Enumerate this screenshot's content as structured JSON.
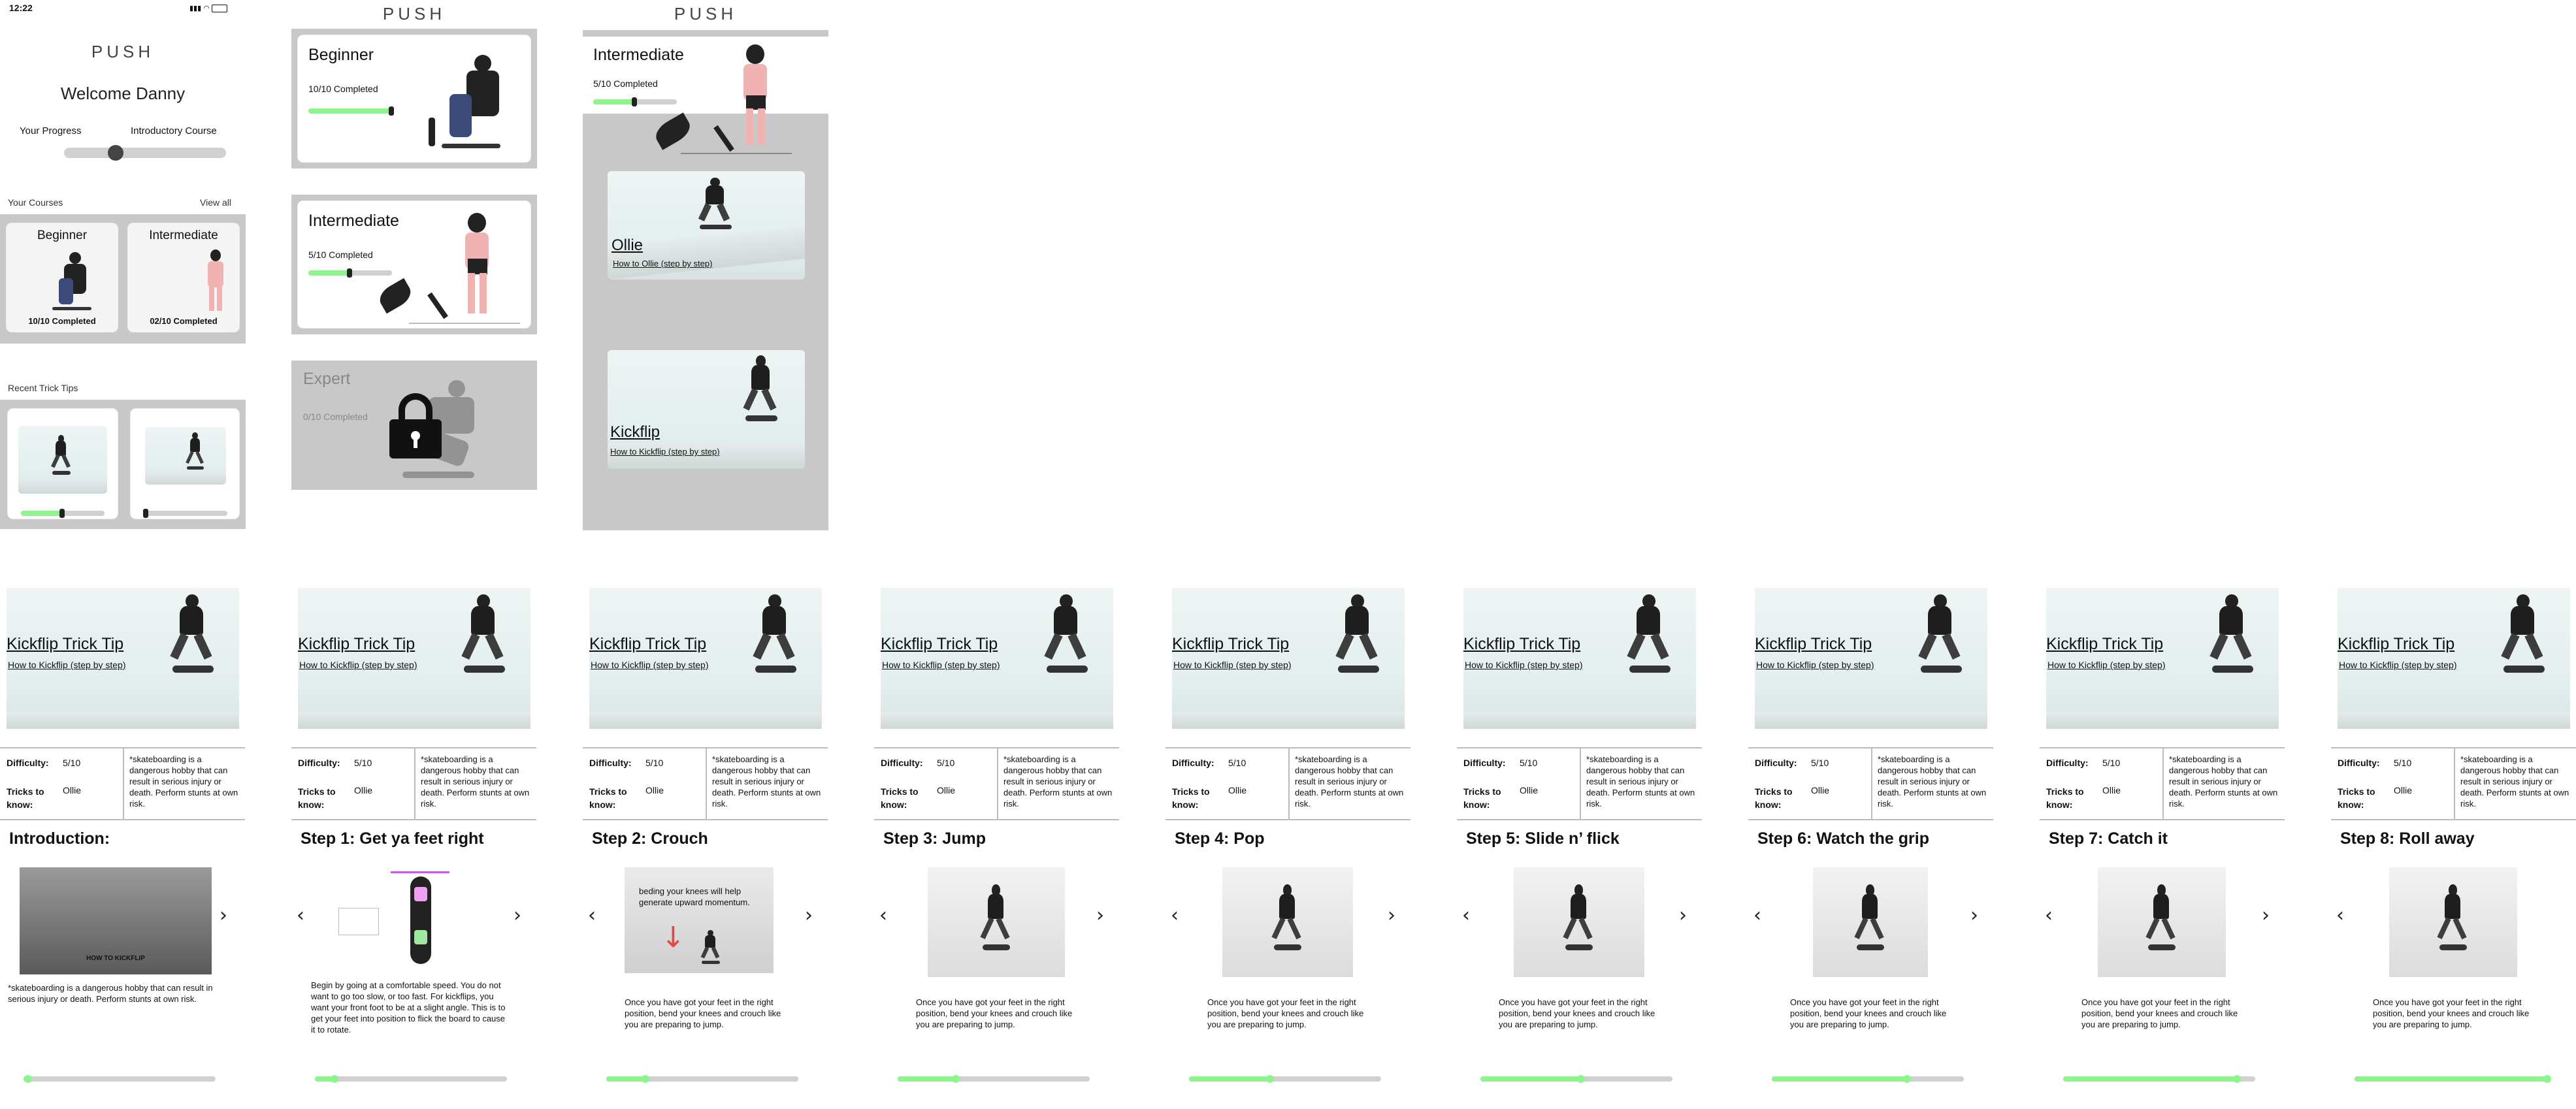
{
  "status_bar": {
    "time": "12:22"
  },
  "brand": "PUSH",
  "home": {
    "welcome": "Welcome Danny",
    "your_progress": "Your Progress",
    "introductory_course": "Introductory Course",
    "progress_value": 0.32,
    "your_courses": "Your Courses",
    "view_all": "View all",
    "courses": [
      {
        "title": "Beginner",
        "completed": "10/10 Completed",
        "progress": 1.0
      },
      {
        "title": "Intermediate",
        "completed": "02/10 Completed",
        "progress": 0.2
      }
    ],
    "recent_trick_tips": "Recent Trick Tips",
    "trick_progress": [
      0.5,
      0.03
    ]
  },
  "courses_screen": {
    "items": [
      {
        "title": "Beginner",
        "completed": "10/10 Completed",
        "progress": 1.0,
        "locked": false
      },
      {
        "title": "Intermediate",
        "completed": "5/10 Completed",
        "progress": 0.5,
        "locked": false
      },
      {
        "title": "Expert",
        "completed": "0/10 Completed",
        "progress": 0.0,
        "locked": true
      }
    ]
  },
  "intermediate_screen": {
    "title": "Intermediate",
    "completed": "5/10 Completed",
    "progress": 0.5,
    "tricks": [
      {
        "name": "Ollie",
        "subtitle": "How to Ollie (step by step)"
      },
      {
        "name": "Kickflip",
        "subtitle": "How to Kickflip (step by step)"
      }
    ]
  },
  "trick_tip": {
    "title": "Kickflip Trick Tip",
    "subtitle": "How to Kickflip (step by step)",
    "difficulty_label": "Difficulty:",
    "difficulty_value": "5/10",
    "tricks_label": "Tricks to know:",
    "tricks_value": "Ollie",
    "disclaimer": "*skateboarding is a dangerous hobby that can result in serious injury or death. Perform stunts at own risk."
  },
  "steps": [
    {
      "title": "Introduction:",
      "video_label": "HOW TO KICKFLIP",
      "body": "*skateboarding is a dangerous hobby that can result in serious injury or death. Perform stunts at own risk.",
      "progress": 0.02
    },
    {
      "title": "Step 1: Get ya feet right",
      "body": "Begin by going at  a comfortable speed. You do not want to go too slow, or too fast. For kickflips, you want your front foot to be at a slight angle. This is to get your feet into position to flick the board to cause it to rotate.",
      "progress": 0.1
    },
    {
      "title": "Step 2: Crouch",
      "overlay": "beding your knees will help generate upward momentum.",
      "body": "Once you have got your feet in the right position, bend your knees and crouch like you are preparing to jump.",
      "progress": 0.2
    },
    {
      "title": "Step 3: Jump",
      "body": "Once you have got your feet in the right position, bend your knees and crouch like you are preparing to jump.",
      "progress": 0.3
    },
    {
      "title": "Step 4: Pop",
      "body": "Once you have got your feet in the right position, bend your knees and crouch like you are preparing to jump.",
      "progress": 0.42
    },
    {
      "title": "Step 5: Slide n’ flick",
      "body": "Once you have got your feet in the right position, bend your knees and crouch like you are preparing to jump.",
      "progress": 0.52
    },
    {
      "title": "Step 6: Watch the grip",
      "body": "Once you have got your feet in the right position, bend your knees and crouch like you are preparing to jump.",
      "progress": 0.7
    },
    {
      "title": "Step 7: Catch it",
      "body": "Once you have got your feet in the right position, bend your knees and crouch like you are preparing to jump.",
      "progress": 0.9
    },
    {
      "title": "Step 8: Roll away",
      "body": "Once you have got your feet in the right position, bend your knees and crouch like you are preparing to jump.",
      "progress": 1.0
    }
  ],
  "colors": {
    "accent": "#8ef48e",
    "panel": "#c8c8c8",
    "track": "#d0d0d0"
  },
  "icons": [
    "chevron-left-icon",
    "chevron-right-icon",
    "lock-icon",
    "signal-icon",
    "wifi-icon",
    "battery-icon"
  ]
}
